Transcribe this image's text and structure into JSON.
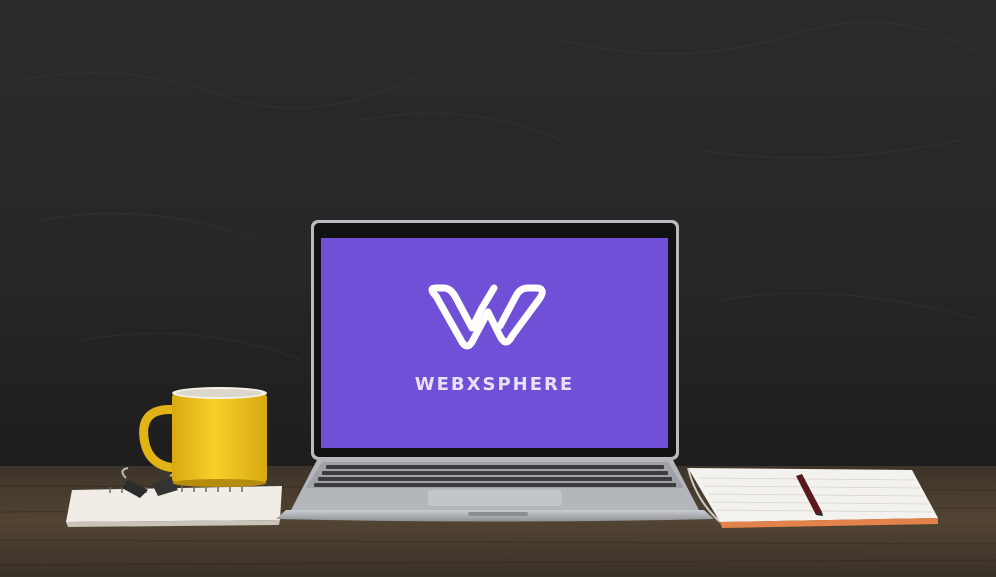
{
  "scene": {
    "description_free": true
  },
  "screen": {
    "background_color": "#6f50d6",
    "logo_icon": "w-icon",
    "brand_name": "WEBXSPHERE"
  },
  "colors": {
    "wall": "#262626",
    "desk": "#4a3e30",
    "mug": "#f0c51e",
    "laptop_silver": "#a9acb0"
  }
}
